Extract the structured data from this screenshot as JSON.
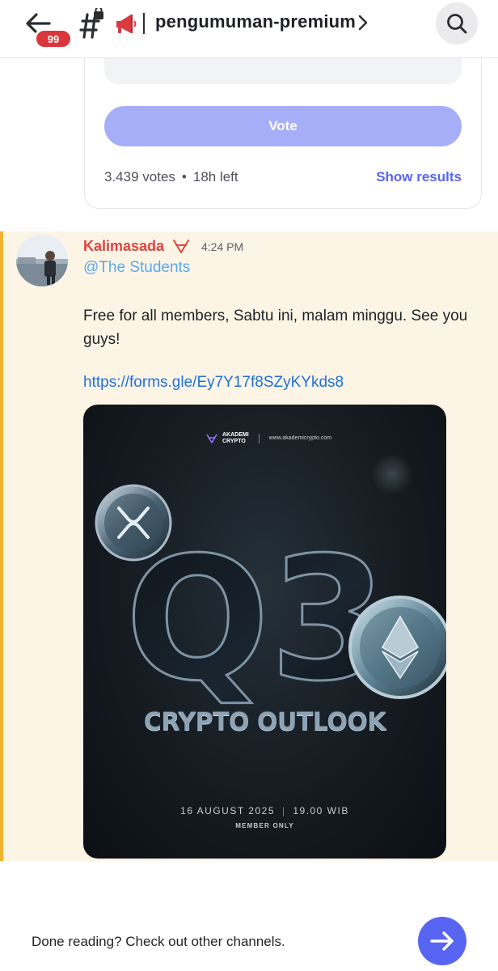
{
  "header": {
    "back_icon": "arrow-left-icon",
    "unread_badge": "99",
    "channel_icon": "hash-lock-icon",
    "channel_emoji": "megaphone-icon",
    "channel_name": "pengumuman-premium",
    "search_icon": "search-icon"
  },
  "poll": {
    "vote_label": "Vote",
    "votes": "3.439 votes",
    "separator": "•",
    "time_left": "18h left",
    "show_results_label": "Show results"
  },
  "message": {
    "author": "Kalimasada",
    "role_icon": "role-crest-icon",
    "timestamp": "4:24 PM",
    "mention": "@The Students",
    "text": "Free for all members, Sabtu ini, malam minggu. See you guys!",
    "link": "https://forms.gle/Ey7Y17f8SZyKYkds8",
    "poster": {
      "brand_line1": "AKADEMI",
      "brand_line2": "CRYPTO",
      "url": "www.akademicrypto.com",
      "big_text": "Q3",
      "title": "CRYPTO OUTLOOK",
      "date": "16 AUGUST 2025",
      "date_sep": "|",
      "time": "19.00 WIB",
      "note": "MEMBER ONLY"
    }
  },
  "footer": {
    "prompt": "Done reading? Check out other channels.",
    "next_icon": "arrow-right-icon"
  },
  "colors": {
    "accent": "#5865f2",
    "vote_button": "#a6aef7",
    "author": "#e2423f",
    "mention": "#5aa8e8",
    "link": "#1f6fd8",
    "highlight_bg": "#fcf5e6",
    "highlight_bar": "#f0b232",
    "badge": "#da373c"
  }
}
